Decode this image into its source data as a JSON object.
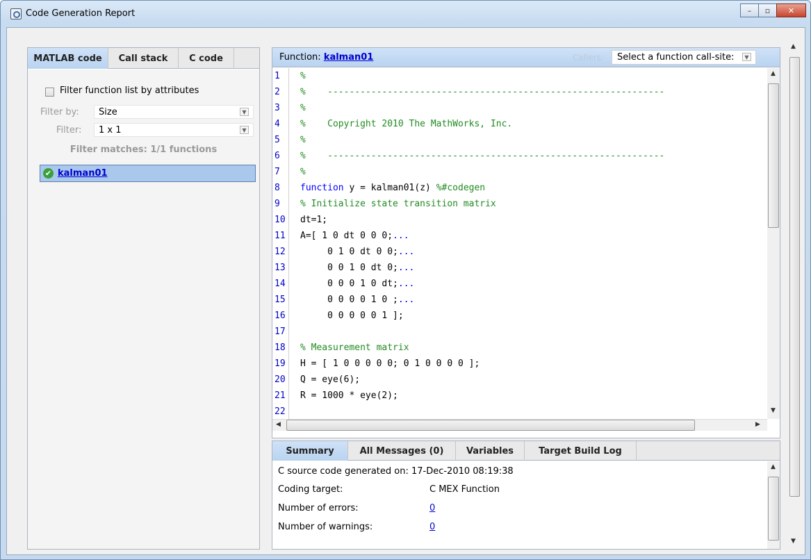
{
  "window": {
    "title": "Code Generation Report",
    "minimize": "–",
    "maximize": "▫",
    "close": "✕"
  },
  "left_tabs": [
    "MATLAB code",
    "Call stack",
    "C code"
  ],
  "filter": {
    "checkbox_label": "Filter function list by attributes",
    "filter_by_label": "Filter by:",
    "filter_by_value": "Size",
    "filter_label": "Filter:",
    "filter_value": "1 x 1",
    "matches": "Filter matches: 1/1 functions"
  },
  "function_list": [
    {
      "name": "kalman01"
    }
  ],
  "code_header": {
    "label": "Function: ",
    "function_name": "kalman01",
    "callers_label": "Callers:",
    "callsite_select": "Select a function call-site:"
  },
  "code_lines": [
    {
      "n": "1",
      "t": "%"
    },
    {
      "n": "2",
      "t": "%    --------------------------------------------------------------"
    },
    {
      "n": "3",
      "t": "%"
    },
    {
      "n": "4",
      "t": "%    Copyright 2010 The MathWorks, Inc."
    },
    {
      "n": "5",
      "t": "%"
    },
    {
      "n": "6",
      "t": "%    --------------------------------------------------------------"
    },
    {
      "n": "7",
      "t": "%"
    },
    {
      "n": "8",
      "kw": "function",
      "t": " y = kalman01(z) ",
      "c": "%#codegen"
    },
    {
      "n": "9",
      "t": "% Initialize state transition matrix"
    },
    {
      "n": "10",
      "t": "dt=1;"
    },
    {
      "n": "11",
      "t": "A=[ 1 0 dt 0 0 0;",
      "cont": "..."
    },
    {
      "n": "12",
      "t": "     0 1 0 dt 0 0;",
      "cont": "..."
    },
    {
      "n": "13",
      "t": "     0 0 1 0 dt 0;",
      "cont": "..."
    },
    {
      "n": "14",
      "t": "     0 0 0 1 0 dt;",
      "cont": "..."
    },
    {
      "n": "15",
      "t": "     0 0 0 0 1 0 ;",
      "cont": "..."
    },
    {
      "n": "16",
      "t": "     0 0 0 0 0 1 ];"
    },
    {
      "n": "17",
      "t": ""
    },
    {
      "n": "18",
      "t": "% Measurement matrix"
    },
    {
      "n": "19",
      "t": "H = [ 1 0 0 0 0 0; 0 1 0 0 0 0 ];"
    },
    {
      "n": "20",
      "t": "Q = eye(6);"
    },
    {
      "n": "21",
      "t": "R = 1000 * eye(2);"
    },
    {
      "n": "22",
      "t": ""
    }
  ],
  "bottom_tabs": [
    "Summary",
    "All Messages (0)",
    "Variables",
    "Target Build Log"
  ],
  "summary": {
    "generated": "C source code generated on: 17-Dec-2010 08:19:38",
    "target_label": "Coding target:",
    "target_value": "C MEX Function",
    "errors_label": "Number of errors:",
    "errors_value": "0",
    "warnings_label": "Number of warnings:",
    "warnings_value": "0"
  }
}
